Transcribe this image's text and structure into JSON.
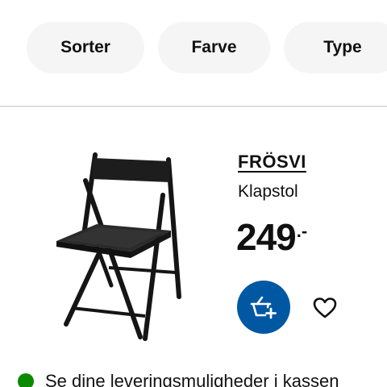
{
  "filters": {
    "sort_label": "Sorter",
    "color_label": "Farve",
    "type_label": "Type"
  },
  "product": {
    "name": "FRÖSVI",
    "description": "Klapstol",
    "price_integer": "249",
    "price_suffix": ".-",
    "image_icon": "folding-chair-image",
    "add_to_cart_icon": "shopping-basket-plus-icon",
    "favourite_icon": "heart-outline-icon"
  },
  "delivery": {
    "text": "Se dine leveringsmuligheder i kassen",
    "status_color": "#0a8a00"
  },
  "colors": {
    "accent": "#0058a3",
    "chip_background": "#f5f5f5"
  }
}
